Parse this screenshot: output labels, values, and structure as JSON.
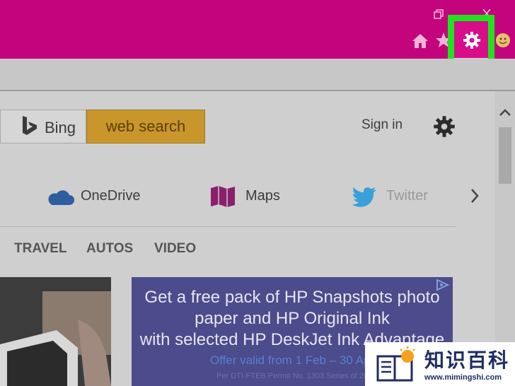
{
  "browser": {
    "window_controls": [
      "restore-icon",
      "close-icon"
    ],
    "toolbar_icons": [
      "home-icon",
      "star-icon",
      "gear-icon",
      "smiley-icon"
    ],
    "accent": "#c4047c",
    "highlight": "#22e21f"
  },
  "search": {
    "provider": "Bing",
    "button": "web search"
  },
  "header": {
    "sign_in": "Sign in"
  },
  "links": [
    {
      "label": "OneDrive",
      "icon": "cloud-icon"
    },
    {
      "label": "Maps",
      "icon": "map-icon"
    },
    {
      "label": "Twitter",
      "icon": "twitter-icon"
    }
  ],
  "categories": [
    "TRAVEL",
    "AUTOS",
    "VIDEO"
  ],
  "ad": {
    "line1": "Get a free pack of HP Snapshots photo",
    "line2": "paper and HP Original Ink",
    "line3": "with selected HP DeskJet Ink Advantage",
    "offer": "Offer valid from 1 Feb – 30 Apr",
    "fine": "Per DTI-FTEB Permit No. 1303 Series of 20"
  },
  "watermark": {
    "text": "知识百科",
    "url": "www.mimingshi.com"
  }
}
